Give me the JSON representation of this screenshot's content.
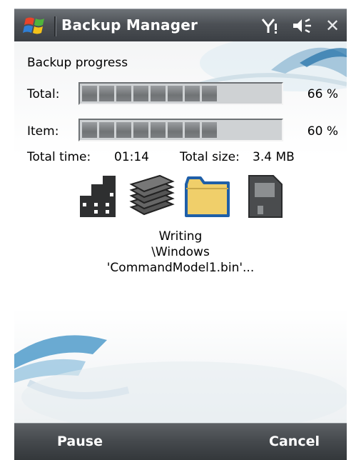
{
  "window": {
    "title": "Backup Manager",
    "close_label": "✕"
  },
  "status_icons": [
    "signal-icon",
    "volume-icon",
    "close-icon"
  ],
  "backup": {
    "section_label": "Backup progress",
    "total_label": "Total:",
    "total_percent": 66,
    "total_percent_text": "66 %",
    "item_label": "Item:",
    "item_percent": 60,
    "item_percent_text": "60 %",
    "total_time_label": "Total time:",
    "total_time_value": "01:14",
    "total_size_label": "Total size:",
    "total_size_value": "3.4 MB"
  },
  "stage_icons": [
    "building-icon",
    "document-stack-icon",
    "folder-icon",
    "memory-card-icon"
  ],
  "status": {
    "line1": "Writing",
    "line2": "\\Windows",
    "line3": "'CommandModel1.bin'..."
  },
  "softkeys": {
    "left": "Pause",
    "right": "Cancel"
  },
  "colors": {
    "titlebar": "#4c5055",
    "softbar": "#44484c",
    "progress_fill": "#7d8083",
    "folder": "#f0cf6a",
    "folder_outline": "#1f5fa8"
  }
}
